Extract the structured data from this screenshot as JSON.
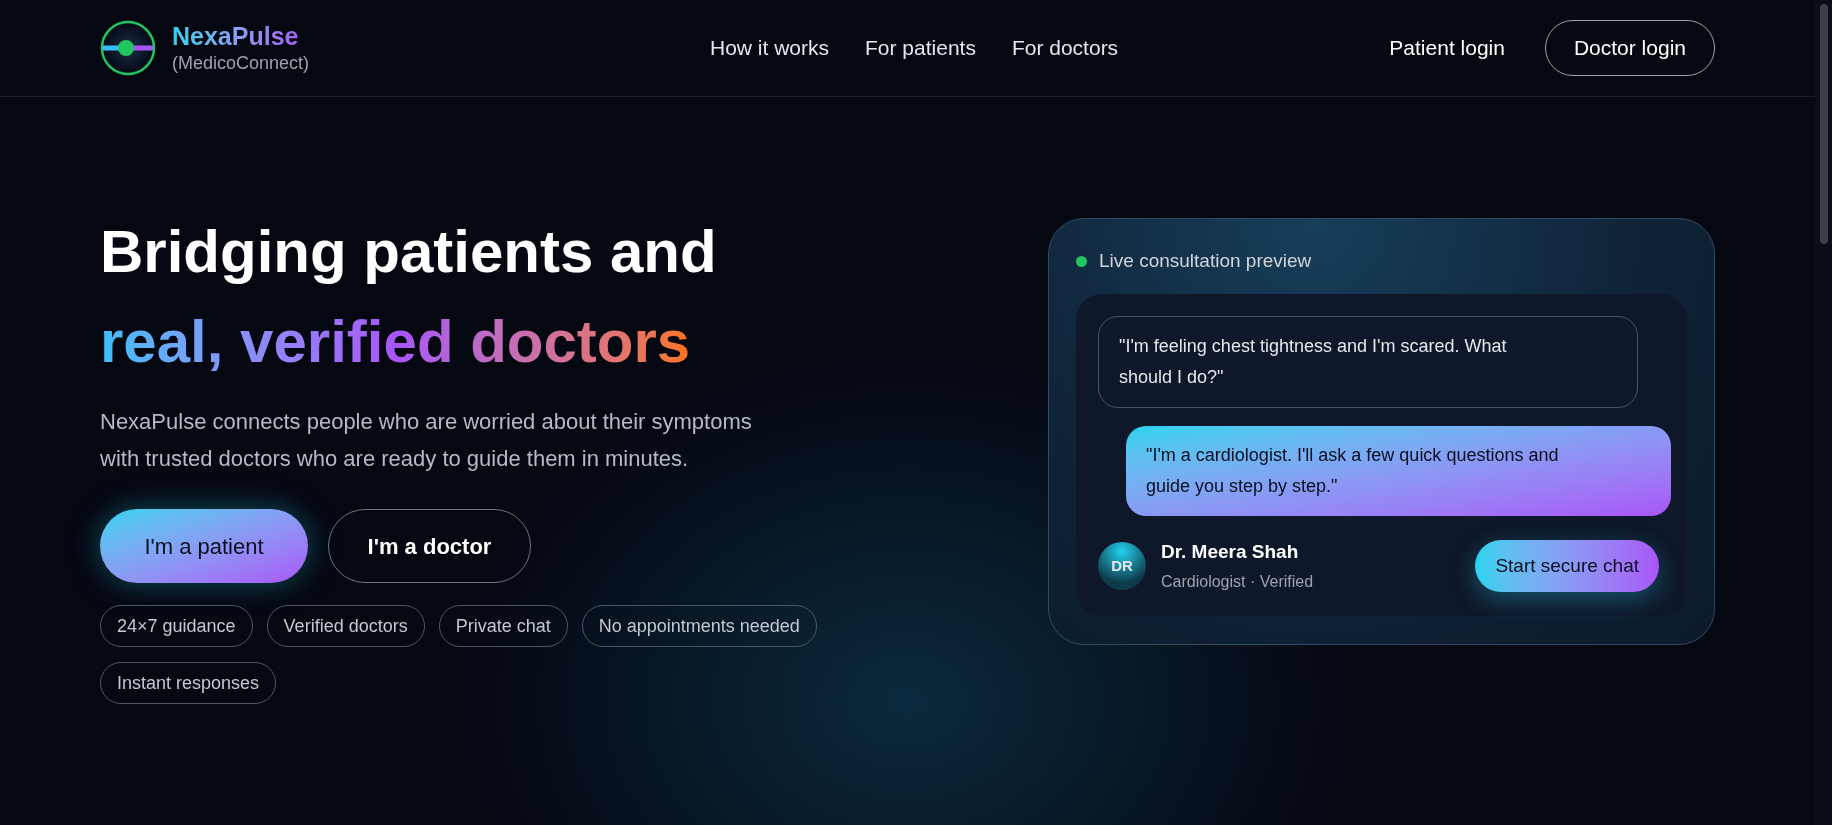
{
  "brand": {
    "name": "NexaPulse",
    "subtitle": "(MedicoConnect)"
  },
  "nav": [
    "How it works",
    "For patients",
    "For doctors"
  ],
  "auth": [
    {
      "label": "Patient login",
      "kind": "link"
    },
    {
      "label": "Doctor login",
      "kind": "outline"
    }
  ],
  "hero": {
    "title": "Bridging patients and",
    "highlight": "real, verified doctors",
    "description": "NexaPulse connects people who are worried about their symptoms with trusted doctors who are ready to guide them in minutes.",
    "buttons": [
      {
        "label": "I'm a patient",
        "kind": "primary"
      },
      {
        "label": "I'm a doctor",
        "kind": "outline"
      }
    ],
    "chips": [
      "24×7 guidance",
      "Verified doctors",
      "Private chat",
      "No appointments needed",
      "Instant responses"
    ]
  },
  "preview": {
    "status": "Live consultation preview",
    "live": true,
    "messages": [
      {
        "kind": "patient",
        "text": "\"I'm feeling chest tightness and I'm scared. What should I do?\""
      },
      {
        "kind": "doctor",
        "text": "\"I'm a cardiologist. I'll ask a few quick questions and guide you step by step.\""
      }
    ],
    "doctor": {
      "initials": "DR",
      "name": "Dr. Meera Shah",
      "role": "Cardiologist · Verified"
    },
    "action": "Start secure chat"
  }
}
